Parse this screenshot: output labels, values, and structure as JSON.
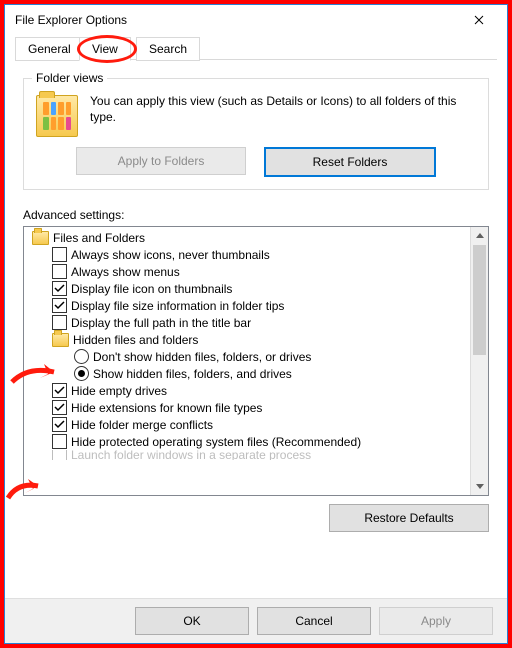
{
  "window": {
    "title": "File Explorer Options"
  },
  "tabs": {
    "general": "General",
    "view": "View",
    "search": "Search"
  },
  "folder_views": {
    "legend": "Folder views",
    "text": "You can apply this view (such as Details or Icons) to all folders of this type.",
    "apply_btn": "Apply to Folders",
    "reset_btn": "Reset Folders"
  },
  "advanced": {
    "label": "Advanced settings:",
    "root": "Files and Folders",
    "items": [
      {
        "type": "check",
        "checked": false,
        "label": "Always show icons, never thumbnails"
      },
      {
        "type": "check",
        "checked": false,
        "label": "Always show menus"
      },
      {
        "type": "check",
        "checked": true,
        "label": "Display file icon on thumbnails"
      },
      {
        "type": "check",
        "checked": true,
        "label": "Display file size information in folder tips"
      },
      {
        "type": "check",
        "checked": false,
        "label": "Display the full path in the title bar"
      }
    ],
    "hidden_group": "Hidden files and folders",
    "hidden_opts": [
      {
        "checked": false,
        "label": "Don't show hidden files, folders, or drives"
      },
      {
        "checked": true,
        "label": "Show hidden files, folders, and drives"
      }
    ],
    "items2": [
      {
        "type": "check",
        "checked": true,
        "label": "Hide empty drives"
      },
      {
        "type": "check",
        "checked": true,
        "label": "Hide extensions for known file types"
      },
      {
        "type": "check",
        "checked": true,
        "label": "Hide folder merge conflicts"
      },
      {
        "type": "check",
        "checked": false,
        "label": "Hide protected operating system files (Recommended)"
      },
      {
        "type": "check",
        "checked": false,
        "label": "Launch folder windows in a separate process"
      }
    ],
    "restore_btn": "Restore Defaults"
  },
  "buttons": {
    "ok": "OK",
    "cancel": "Cancel",
    "apply": "Apply"
  }
}
